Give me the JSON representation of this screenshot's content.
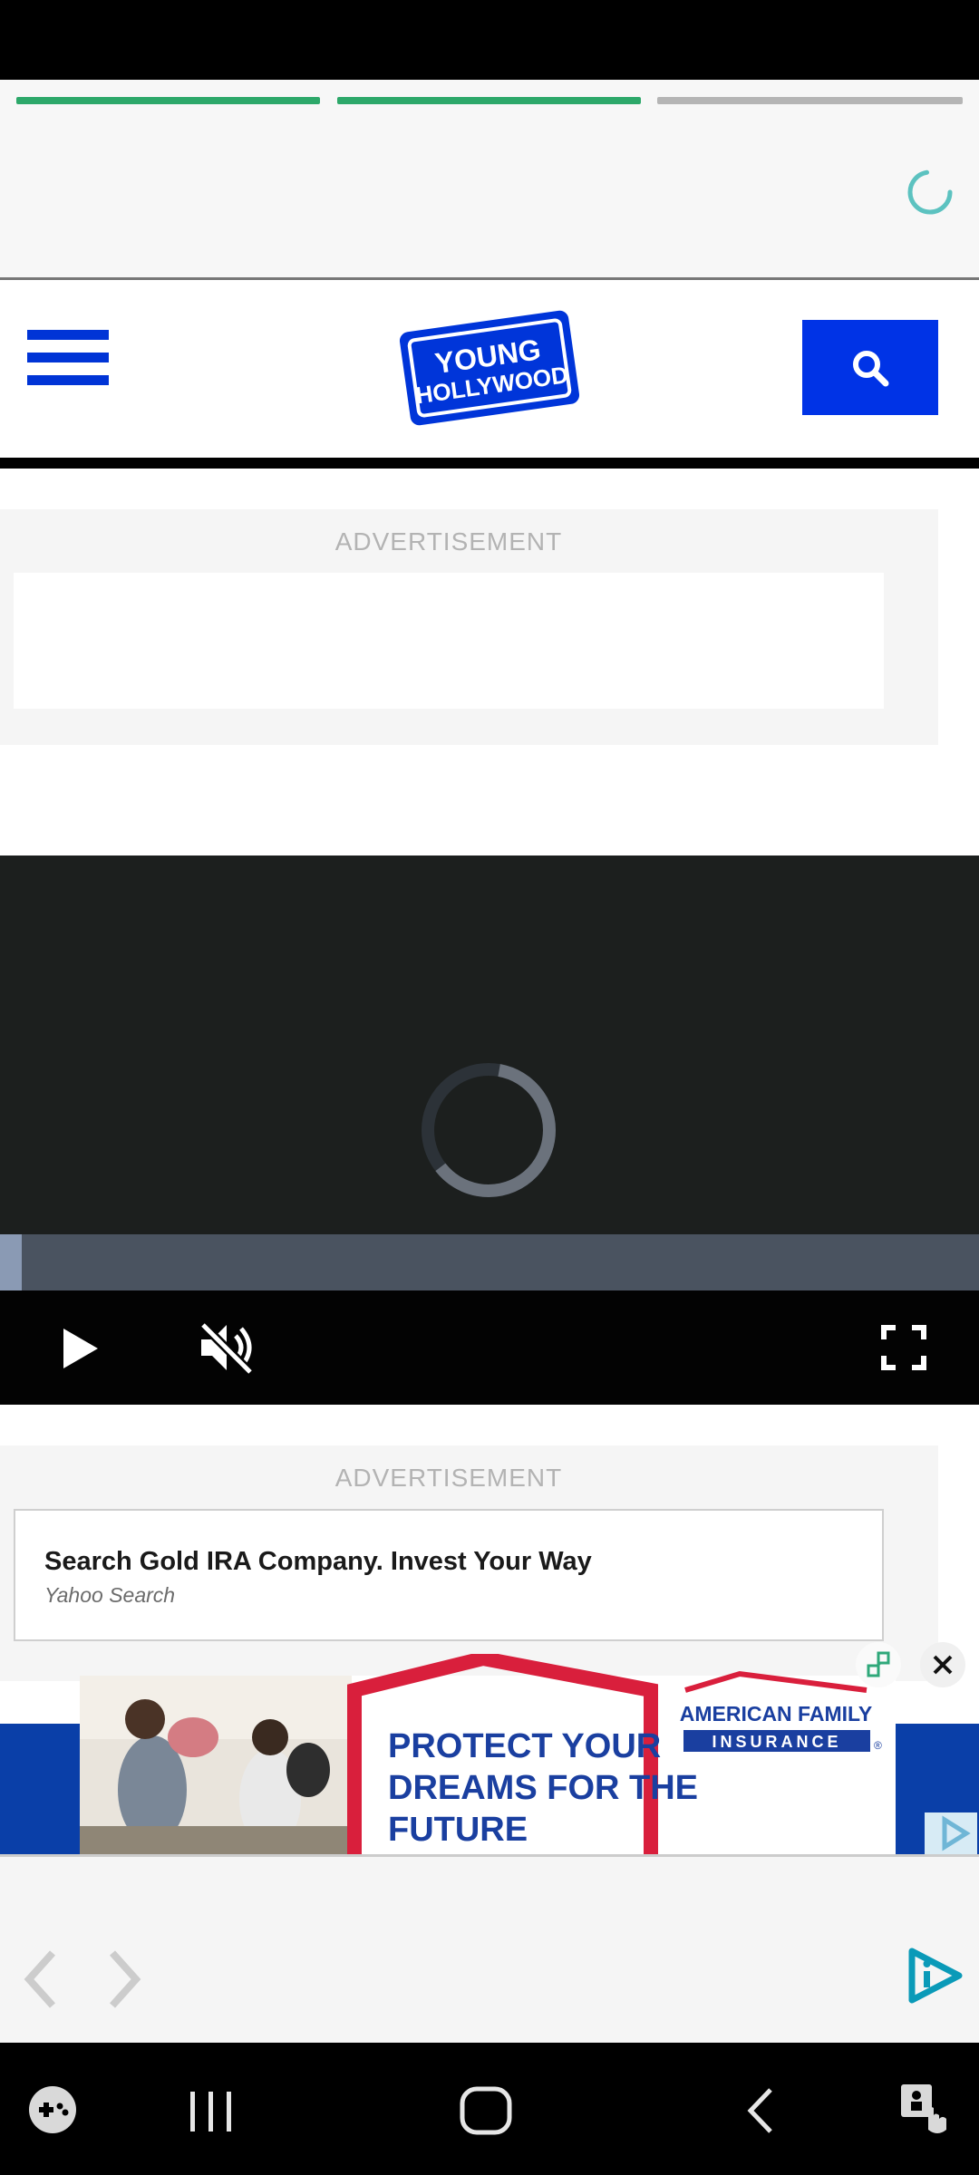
{
  "header": {
    "logo_line1": "YOUNG",
    "logo_line2": "HOLLYWOOD"
  },
  "story_progress": [
    1,
    1,
    0
  ],
  "colors": {
    "brand_blue": "#0033e6",
    "progress_done": "#2da86a",
    "progress_pending": "#b5b5b5"
  },
  "ads": {
    "label_top": "ADVERTISEMENT",
    "label_mid": "ADVERTISEMENT",
    "mid_title": "Search Gold IRA Company. Invest Your Way",
    "mid_source": "Yahoo Search"
  },
  "video": {
    "icons": [
      "play-icon",
      "muted-icon",
      "fullscreen-icon"
    ],
    "progress": 0.02
  },
  "banner_ad": {
    "headline_1": "PROTECT YOUR",
    "headline_2": "DREAMS FOR THE",
    "headline_3": "FUTURE",
    "brand_1": "AMERICAN FAMILY",
    "brand_2": "INSURANCE",
    "brand_mark": "®"
  },
  "nav_icons": [
    "game-launcher-icon",
    "recent-apps-icon",
    "home-icon",
    "back-icon",
    "accessibility-icon"
  ]
}
